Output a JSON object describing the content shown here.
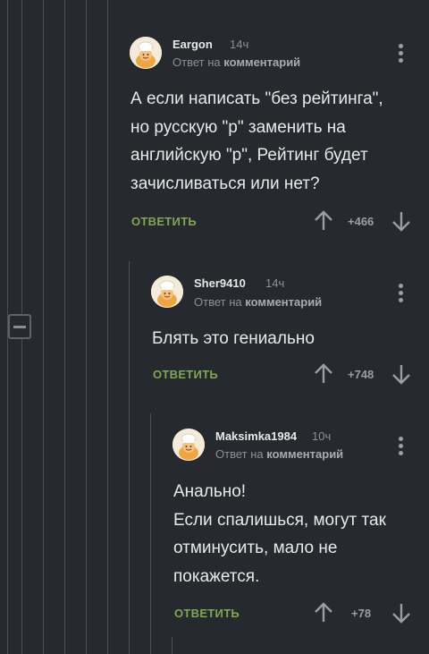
{
  "comments": [
    {
      "author": "Eargon",
      "time": "14ч",
      "reply_prefix": "Ответ на",
      "reply_link": "комментарий",
      "text": "А если написать \"без рейтинга\",\nно русскую \"р\" заменить на\nанглийскую \"р\", Рейтинг будет\nзачисливаться или нет?",
      "reply_label": "ОТВЕТИТЬ",
      "rating": "+466"
    },
    {
      "author": "Sher9410",
      "time": "14ч",
      "reply_prefix": "Ответ на",
      "reply_link": "комментарий",
      "text": "Блять это гениально",
      "reply_label": "ОТВЕТИТЬ",
      "rating": "+748"
    },
    {
      "author": "Maksimka1984",
      "time": "10ч",
      "reply_prefix": "Ответ на",
      "reply_link": "комментарий",
      "text": "Анально!\nЕсли спалишься, могут так\nотминусить, мало не\nпокажется.",
      "reply_label": "ОТВЕТИТЬ",
      "rating": "+78"
    }
  ],
  "colors": {
    "background": "#26292d",
    "reply_green": "#7ea852",
    "muted_text": "#8d9096",
    "thread_line": "#4a4d52"
  },
  "icons": [
    "avatar-chef-icon",
    "more-vert-icon",
    "arrow-up-icon",
    "arrow-down-icon",
    "collapse-minus-icon"
  ]
}
